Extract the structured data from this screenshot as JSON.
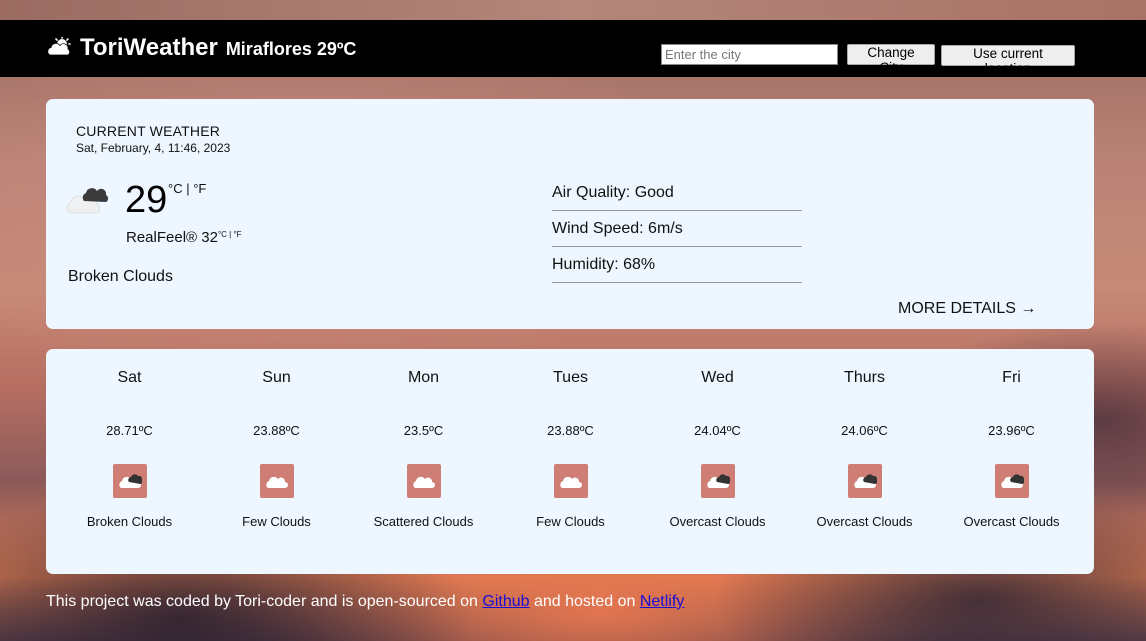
{
  "header": {
    "brand_name": "ToriWeather",
    "city_temp": "Miraflores 29ºC",
    "search_placeholder": "Enter the city",
    "change_city_label": "Change City",
    "current_location_label": "Use current location"
  },
  "current": {
    "title": "CURRENT WEATHER",
    "date": "Sat, February, 4, 11:46, 2023",
    "temperature": "29",
    "units": "°C | °F",
    "realfeel_label": "RealFeel® 32",
    "realfeel_units": "°C | °F",
    "description": "Broken Clouds",
    "air_quality": "Air Quality: Good",
    "wind_speed": "Wind Speed: 6m/s",
    "humidity": "Humidity: 68%",
    "more_details": "MORE DETAILS →"
  },
  "forecast": [
    {
      "day": "Sat",
      "temp": "28.71ºC",
      "desc": "Broken Clouds",
      "icon": "broken-clouds-icon"
    },
    {
      "day": "Sun",
      "temp": "23.88ºC",
      "desc": "Few Clouds",
      "icon": "few-clouds-icon"
    },
    {
      "day": "Mon",
      "temp": "23.5ºC",
      "desc": "Scattered Clouds",
      "icon": "scattered-clouds-icon"
    },
    {
      "day": "Tues",
      "temp": "23.88ºC",
      "desc": "Few Clouds",
      "icon": "few-clouds-icon"
    },
    {
      "day": "Wed",
      "temp": "24.04ºC",
      "desc": "Overcast Clouds",
      "icon": "overcast-clouds-icon"
    },
    {
      "day": "Thurs",
      "temp": "24.06ºC",
      "desc": "Overcast Clouds",
      "icon": "overcast-clouds-icon"
    },
    {
      "day": "Fri",
      "temp": "23.96ºC",
      "desc": "Overcast Clouds",
      "icon": "overcast-clouds-icon"
    }
  ],
  "footer": {
    "text_before": "This project was coded by Tori-coder and is open-sourced on ",
    "github_label": "Github",
    "text_middle": " and hosted on ",
    "netlify_label": "Netlify"
  },
  "colors": {
    "header_bg": "#000000",
    "card_bg": "#eef7ff",
    "icon_tile": "#cf7e76",
    "link": "#1a0dd6"
  }
}
